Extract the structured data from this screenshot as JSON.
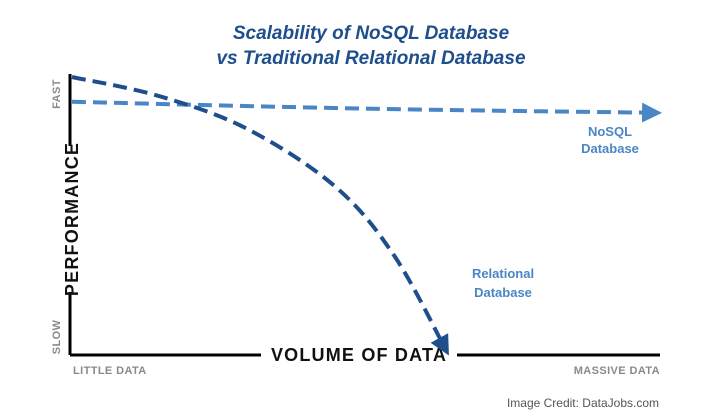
{
  "chart_data": {
    "type": "line",
    "title_line1": "Scalability of NoSQL Database",
    "title_line2": "vs Traditional Relational Database",
    "xlabel": "VOLUME OF DATA",
    "ylabel": "PERFORMANCE",
    "x_ticks": [
      "LITTLE DATA",
      "MASSIVE DATA"
    ],
    "y_ticks": [
      "SLOW",
      "FAST"
    ],
    "xlim": [
      0,
      1
    ],
    "ylim": [
      0,
      1
    ],
    "grid": false,
    "series": [
      {
        "name": "NoSQL\nDatabase",
        "label_lines": [
          "NoSQL",
          "Database"
        ],
        "color": "#4a86c5",
        "style": "dashed",
        "arrow": true,
        "points": [
          [
            0.0,
            0.91
          ],
          [
            0.5,
            0.885
          ],
          [
            1.0,
            0.87
          ]
        ]
      },
      {
        "name": "Relational Database",
        "label_lines": [
          "Relational",
          "Database"
        ],
        "color": "#1f4e8c",
        "style": "dashed",
        "arrow": true,
        "points": [
          [
            0.0,
            1.0
          ],
          [
            0.15,
            0.93
          ],
          [
            0.3,
            0.81
          ],
          [
            0.45,
            0.6
          ],
          [
            0.55,
            0.35
          ],
          [
            0.64,
            0.0
          ]
        ]
      }
    ]
  },
  "credit": "Image Credit: DataJobs.com"
}
